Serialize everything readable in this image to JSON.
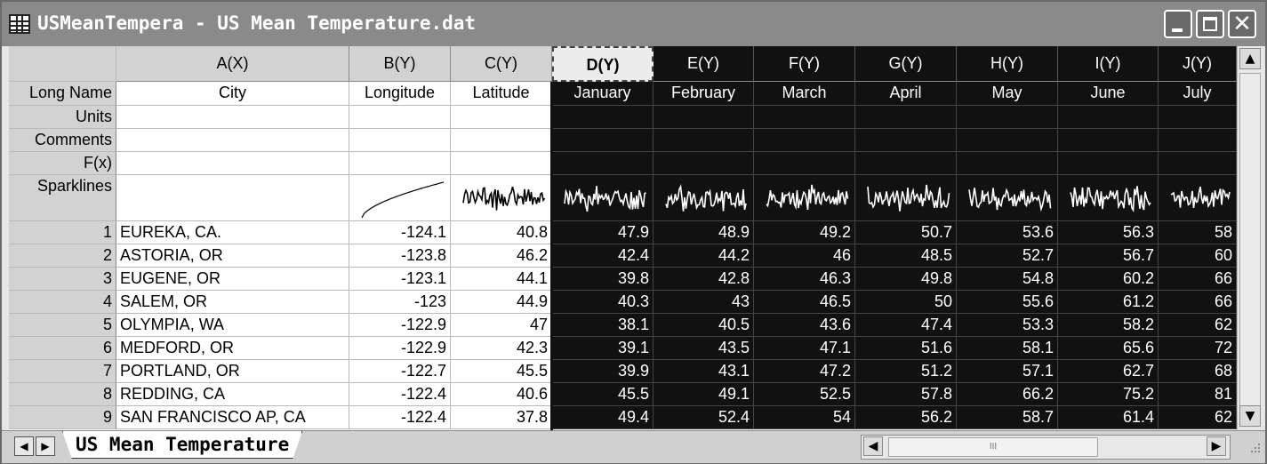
{
  "window": {
    "title": "USMeanTempera - US Mean Temperature.dat",
    "buttons": {
      "minimize": "minimize",
      "maximize": "maximize",
      "close": "✕"
    }
  },
  "columns": [
    {
      "header": "A(X)",
      "long_name": "City"
    },
    {
      "header": "B(Y)",
      "long_name": "Longitude"
    },
    {
      "header": "C(Y)",
      "long_name": "Latitude"
    },
    {
      "header": "D(Y)",
      "long_name": "January"
    },
    {
      "header": "E(Y)",
      "long_name": "February"
    },
    {
      "header": "F(Y)",
      "long_name": "March"
    },
    {
      "header": "G(Y)",
      "long_name": "April"
    },
    {
      "header": "H(Y)",
      "long_name": "May"
    },
    {
      "header": "I(Y)",
      "long_name": "June"
    },
    {
      "header": "J(Y)",
      "long_name": "July"
    }
  ],
  "property_rows": [
    "Long Name",
    "Units",
    "Comments",
    "F(x)",
    "Sparklines"
  ],
  "rows": [
    {
      "n": "1",
      "cells": [
        "EUREKA, CA.",
        "-124.1",
        "40.8",
        "47.9",
        "48.9",
        "49.2",
        "50.7",
        "53.6",
        "56.3",
        "58"
      ]
    },
    {
      "n": "2",
      "cells": [
        "ASTORIA, OR",
        "-123.8",
        "46.2",
        "42.4",
        "44.2",
        "46",
        "48.5",
        "52.7",
        "56.7",
        "60"
      ]
    },
    {
      "n": "3",
      "cells": [
        "EUGENE, OR",
        "-123.1",
        "44.1",
        "39.8",
        "42.8",
        "46.3",
        "49.8",
        "54.8",
        "60.2",
        "66"
      ]
    },
    {
      "n": "4",
      "cells": [
        "SALEM, OR",
        "-123",
        "44.9",
        "40.3",
        "43",
        "46.5",
        "50",
        "55.6",
        "61.2",
        "66"
      ]
    },
    {
      "n": "5",
      "cells": [
        "OLYMPIA, WA",
        "-122.9",
        "47",
        "38.1",
        "40.5",
        "43.6",
        "47.4",
        "53.3",
        "58.2",
        "62"
      ]
    },
    {
      "n": "6",
      "cells": [
        "MEDFORD, OR",
        "-122.9",
        "42.3",
        "39.1",
        "43.5",
        "47.1",
        "51.6",
        "58.1",
        "65.6",
        "72"
      ]
    },
    {
      "n": "7",
      "cells": [
        "PORTLAND, OR",
        "-122.7",
        "45.5",
        "39.9",
        "43.1",
        "47.2",
        "51.2",
        "57.1",
        "62.7",
        "68"
      ]
    },
    {
      "n": "8",
      "cells": [
        "REDDING, CA",
        "-122.4",
        "40.6",
        "45.5",
        "49.1",
        "52.5",
        "57.8",
        "66.2",
        "75.2",
        "81"
      ]
    },
    {
      "n": "9",
      "cells": [
        "SAN FRANCISCO AP, CA",
        "-122.4",
        "37.8",
        "49.4",
        "52.4",
        "54",
        "56.2",
        "58.7",
        "61.4",
        "62"
      ]
    }
  ],
  "sheet_tab": "US Mean Temperature",
  "hscroll_grip": "III",
  "icons": [
    "grid-icon",
    "minimize-icon",
    "maximize-icon",
    "close-icon",
    "scroll-up-icon",
    "scroll-down-icon",
    "scroll-left-icon",
    "scroll-right-icon",
    "first-sheet-icon",
    "next-sheet-icon",
    "resize-grip-icon"
  ],
  "colors": {
    "selection": "#111111",
    "header": "#d2d2d2",
    "titlebar": "#8a8a8a"
  }
}
